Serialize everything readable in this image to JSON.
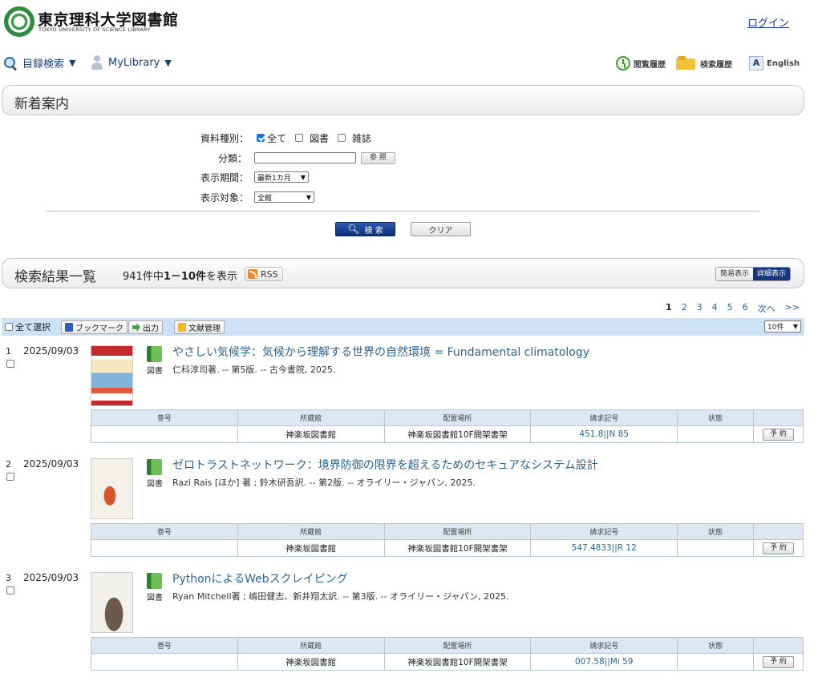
{
  "header": {
    "title": "東京理科大学図書館",
    "subtitle": "TOKYO UNIVERSITY OF SCIENCE LIBRARY",
    "login": "ログイン"
  },
  "nav": {
    "catalog_search": "目録検索",
    "mylibrary": "MyLibrary",
    "browse_history": "閲覧履歴",
    "search_history": "検索履歴",
    "english": "English"
  },
  "new_arrivals": {
    "title": "新着案内",
    "material_type_label": "資料種別：",
    "type_all": "全て",
    "type_book": "図書",
    "type_magazine": "雑誌",
    "classification_label": "分類：",
    "browse_button": "参 照",
    "period_label": "表示期間：",
    "period_value": "最新1カ月",
    "target_label": "表示対象：",
    "target_value": "全館",
    "search_button": "検 索",
    "clear_button": "クリア"
  },
  "results": {
    "title": "検索結果一覧",
    "count_prefix": "941件中",
    "count_range": "1－10件",
    "count_suffix": "を表示",
    "rss": "RSS",
    "view_simple": "簡易表示",
    "view_detail": "詳細表示",
    "pagination": [
      "1",
      "2",
      "3",
      "4",
      "5",
      "6",
      "次へ",
      ">>"
    ],
    "select_all": "全て選択",
    "bookmark": "ブックマーク",
    "output": "出力",
    "reference_mgmt": "文献管理",
    "per_page": "10件"
  },
  "holding_headers": [
    "巻号",
    "所蔵館",
    "配置場所",
    "請求記号",
    "状態",
    ""
  ],
  "reserve_label": "予 約",
  "records": [
    {
      "num": "1",
      "date": "2025/09/03",
      "type": "図書",
      "title": "やさしい気候学：気候から理解する世界の自然環境 = Fundamental climatology",
      "author": "仁科淳司著. -- 第5版. -- 古今書院, 2025.",
      "library": "神楽坂図書館",
      "location": "神楽坂図書館10F開架書架",
      "call_number": "451.8||N 85"
    },
    {
      "num": "2",
      "date": "2025/09/03",
      "type": "図書",
      "title": "ゼロトラストネットワーク：境界防御の限界を超えるためのセキュアなシステム設計",
      "author": "Razi Rais [ほか] 著 ; 鈴木研吾訳. -- 第2版. -- オライリー・ジャパン, 2025.",
      "library": "神楽坂図書館",
      "location": "神楽坂図書館10F開架書架",
      "call_number": "547.4833||R 12"
    },
    {
      "num": "3",
      "date": "2025/09/03",
      "type": "図書",
      "title": "PythonによるWebスクレイピング",
      "author": "Ryan Mitchell著 ; 嶋田健志、新井翔太訳. -- 第3版. -- オライリー・ジャパン, 2025.",
      "library": "神楽坂図書館",
      "location": "神楽坂図書館10F開架書架",
      "call_number": "007.58||Mi 59"
    }
  ]
}
